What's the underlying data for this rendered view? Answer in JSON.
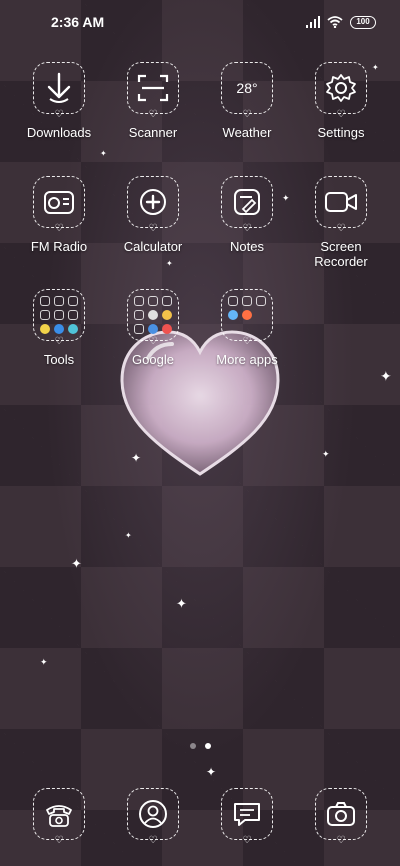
{
  "status_bar": {
    "time": "2:36 AM",
    "battery": "100",
    "signal_icon": "signal-icon",
    "wifi_icon": "wifi-icon"
  },
  "apps": [
    {
      "label": "Downloads",
      "icon": "download-arrow-icon"
    },
    {
      "label": "Scanner",
      "icon": "scanner-frame-icon"
    },
    {
      "label": "Weather",
      "icon": "weather-icon",
      "temp": "28°"
    },
    {
      "label": "Settings",
      "icon": "gear-icon"
    },
    {
      "label": "FM Radio",
      "icon": "radio-icon"
    },
    {
      "label": "Calculator",
      "icon": "calculator-icon"
    },
    {
      "label": "Notes",
      "icon": "notes-icon"
    },
    {
      "label": "Screen Recorder",
      "icon": "video-camera-icon"
    }
  ],
  "folders": [
    {
      "label": "Tools"
    },
    {
      "label": "Google"
    },
    {
      "label": "More apps"
    }
  ],
  "page_indicator": {
    "count": 2,
    "active": 2
  },
  "dock": [
    {
      "name": "phone",
      "icon": "phone-icon"
    },
    {
      "name": "contacts",
      "icon": "contacts-icon"
    },
    {
      "name": "messages",
      "icon": "message-icon"
    },
    {
      "name": "camera",
      "icon": "camera-icon"
    }
  ],
  "colors": {
    "checker_light": "#3c3038",
    "checker_dark": "#2f252d",
    "heart_fill": "#d8b8d0"
  }
}
